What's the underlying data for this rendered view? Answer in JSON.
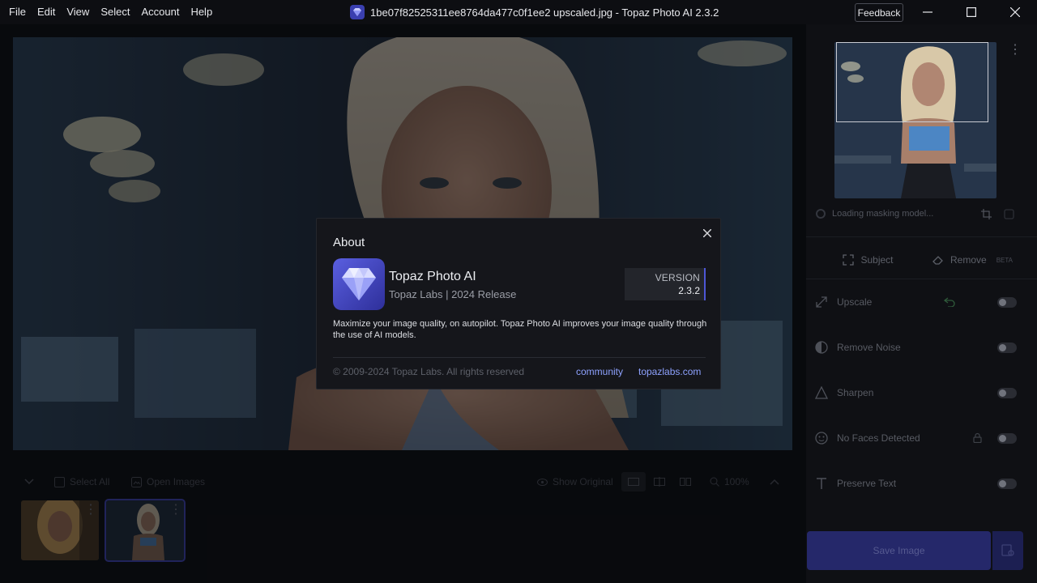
{
  "menu": [
    "File",
    "Edit",
    "View",
    "Select",
    "Account",
    "Help"
  ],
  "window": {
    "title": "1be07f82525311ee8764da477c0f1ee2 upscaled.jpg - Topaz Photo AI 2.3.2",
    "feedback_label": "Feedback",
    "controls": [
      "minimize-icon",
      "maximize-icon",
      "close-icon"
    ]
  },
  "right_panel": {
    "masking_status": "Loading masking model...",
    "tabs": [
      {
        "label": "Subject",
        "icon": "subject-select-icon"
      },
      {
        "label": "Remove",
        "icon": "eraser-icon",
        "badge": "BETA"
      }
    ],
    "filters": [
      {
        "label": "Upscale",
        "icon": "upscale-icon",
        "enabled": false
      },
      {
        "label": "Remove Noise",
        "icon": "noise-icon",
        "enabled": false
      },
      {
        "label": "Sharpen",
        "icon": "sharpen-icon",
        "enabled": false
      },
      {
        "label": "No Faces Detected",
        "icon": "face-icon",
        "enabled": false
      },
      {
        "label": "Preserve Text",
        "icon": "text-icon",
        "enabled": false
      }
    ],
    "save_label": "Save Image"
  },
  "bottom_toolbar": {
    "select_all": "Select All",
    "open_images": "Open Images",
    "show_original": "Show Original",
    "zoom": "100%"
  },
  "about": {
    "title": "About",
    "app_name": "Topaz Photo AI",
    "app_sub": "Topaz Labs | 2024 Release",
    "version_label": "VERSION",
    "version": "2.3.2",
    "description": "Maximize your image quality, on autopilot. Topaz Photo AI improves your image quality through the use of AI models.",
    "copyright": "© 2009-2024 Topaz Labs. All rights reserved",
    "links": [
      "community",
      "topazlabs.com"
    ]
  },
  "colors": {
    "accent": "#4d56d6",
    "link": "#8ea2ff",
    "dialog_bg": "#15161b"
  }
}
